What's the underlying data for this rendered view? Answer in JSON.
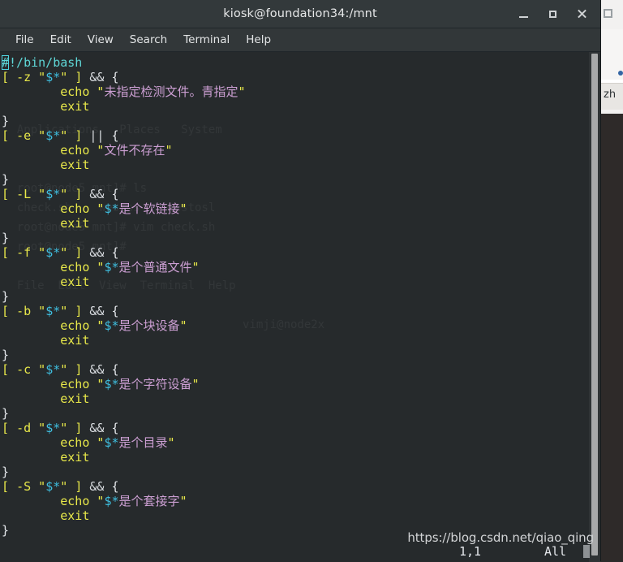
{
  "window": {
    "title": "kiosk@foundation34:/mnt",
    "buttons": {
      "minimize": "minimize",
      "maximize": "maximize",
      "close": "close"
    }
  },
  "menubar": {
    "items": [
      {
        "label": "File"
      },
      {
        "label": "Edit"
      },
      {
        "label": "View"
      },
      {
        "label": "Search"
      },
      {
        "label": "Terminal"
      },
      {
        "label": "Help"
      }
    ]
  },
  "editor": {
    "lines": [
      {
        "id": "l1",
        "text": "#!/bin/bash"
      },
      {
        "id": "l2",
        "text": "[ -z \"$*\" ] && {"
      },
      {
        "id": "l3",
        "text": "        echo \"未指定检测文件。青指定\""
      },
      {
        "id": "l4",
        "text": "        exit"
      },
      {
        "id": "l5",
        "text": "}"
      },
      {
        "id": "l6",
        "text": "[ -e \"$*\" ] || {"
      },
      {
        "id": "l7",
        "text": "        echo \"文件不存在\""
      },
      {
        "id": "l8",
        "text": "        exit"
      },
      {
        "id": "l9",
        "text": "}"
      },
      {
        "id": "l10",
        "text": "[ -L \"$*\" ] && {"
      },
      {
        "id": "l11",
        "text": "        echo \"$*是个软链接\""
      },
      {
        "id": "l12",
        "text": "        exit"
      },
      {
        "id": "l13",
        "text": "}"
      },
      {
        "id": "l14",
        "text": "[ -f \"$*\" ] && {"
      },
      {
        "id": "l15",
        "text": "        echo \"$*是个普通文件\""
      },
      {
        "id": "l16",
        "text": "        exit"
      },
      {
        "id": "l17",
        "text": "}"
      },
      {
        "id": "l18",
        "text": "[ -b \"$*\" ] && {"
      },
      {
        "id": "l19",
        "text": "        echo \"$*是个块设备\""
      },
      {
        "id": "l20",
        "text": "        exit"
      },
      {
        "id": "l21",
        "text": "}"
      },
      {
        "id": "l22",
        "text": "[ -c \"$*\" ] && {"
      },
      {
        "id": "l23",
        "text": "        echo \"$*是个字符设备\""
      },
      {
        "id": "l24",
        "text": "        exit"
      },
      {
        "id": "l25",
        "text": "}"
      },
      {
        "id": "l26",
        "text": "[ -d \"$*\" ] && {"
      },
      {
        "id": "l27",
        "text": "        echo \"$*是个目录\""
      },
      {
        "id": "l28",
        "text": "        exit"
      },
      {
        "id": "l29",
        "text": "}"
      },
      {
        "id": "l30",
        "text": "[ -S \"$*\" ] && {"
      },
      {
        "id": "l31",
        "text": "        echo \"$*是个套接字\""
      },
      {
        "id": "l32",
        "text": "        exit"
      },
      {
        "id": "l33",
        "text": "}"
      }
    ],
    "tokens": {
      "shebang": "#!/bin/bash",
      "open_bracket": "[",
      "close_bracket": "]",
      "quote": "\"",
      "variable": "$*",
      "and_op": "&&",
      "or_op": "||",
      "open_brace": "{",
      "close_brace": "}",
      "echo": "echo",
      "exit": "exit",
      "flags": [
        "-z",
        "-e",
        "-L",
        "-f",
        "-b",
        "-c",
        "-d",
        "-S"
      ],
      "strings": [
        "未指定检测文件。青指定",
        "文件不存在",
        "是个软链接",
        "是个普通文件",
        "是个块设备",
        "是个字符设备",
        "是个目录",
        "是个套接字"
      ]
    }
  },
  "statusline": {
    "position": "1,1",
    "scroll_percent": "All"
  },
  "watermark": {
    "text": "https://blog.csdn.net/qiao_qing"
  },
  "background_window": {
    "ime_label": "zh"
  },
  "colors": {
    "terminal_bg": "#262a2c",
    "titlebar_bg": "#33393b",
    "comment": "#5fd7d7",
    "keyword_yellow": "#e8e84a",
    "variable_cyan": "#3fbfe0",
    "string_pink": "#cc9fd3",
    "operator": "#d9dce0",
    "cursor": "#4fd4e0"
  }
}
